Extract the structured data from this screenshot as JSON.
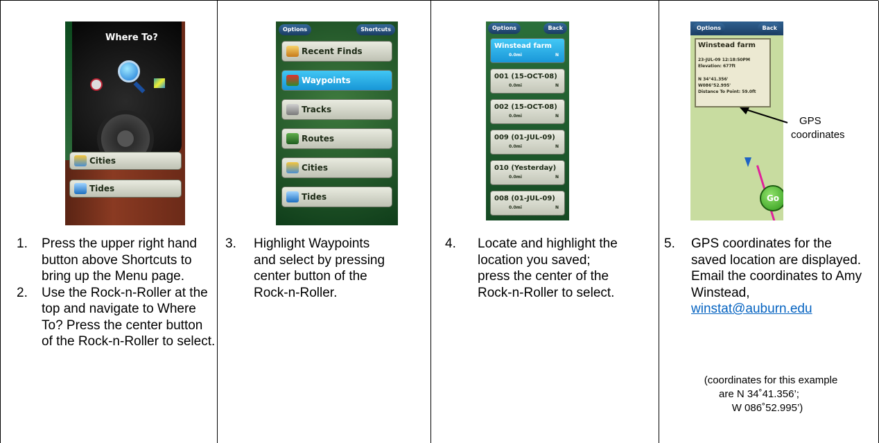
{
  "steps": {
    "step1": {
      "num": "1.",
      "text": "Press the upper right hand button above Shortcuts to bring up the Menu page."
    },
    "step2": {
      "num": "2.",
      "text": "Use the Rock-n-Roller at the top and navigate to Where To? Press the center button of the Rock-n-Roller to select."
    },
    "step3": {
      "num": "3.",
      "text": "Highlight Waypoints and select by pressing center button of the Rock-n-Roller."
    },
    "step4": {
      "num": "4.",
      "text": "Locate and highlight the location you saved; press the center of the Rock-n-Roller to select."
    },
    "step5": {
      "num": "5.",
      "text_before": "GPS coordinates for the saved location are displayed. Email the coordinates to Amy Winstead,",
      "email": "winstat@auburn.edu"
    }
  },
  "note": {
    "line1": "(coordinates for this example",
    "line2": "are N 34˚41.356’;",
    "line3": "W 086˚52.995’)"
  },
  "callout": {
    "line1": "GPS",
    "line2": "coordinates"
  },
  "screen1": {
    "title": "Where To?",
    "items": [
      "Cities",
      "Tides"
    ]
  },
  "screen2": {
    "options": "Options",
    "shortcuts": "Shortcuts",
    "items": [
      "Recent Finds",
      "Waypoints",
      "Tracks",
      "Routes",
      "Cities",
      "Tides"
    ],
    "selected": "Waypoints"
  },
  "screen3": {
    "options": "Options",
    "back": "Back",
    "waypoints": [
      {
        "name": "Winstead farm",
        "dist": "0.0mi",
        "dir": "N"
      },
      {
        "name": "001 (15-OCT-08)",
        "dist": "0.0mi",
        "dir": "N"
      },
      {
        "name": "002 (15-OCT-08)",
        "dist": "0.0mi",
        "dir": "N"
      },
      {
        "name": "009 (01-JUL-09)",
        "dist": "0.0mi",
        "dir": "N"
      },
      {
        "name": "010 (Yesterday)",
        "dist": "0.0mi",
        "dir": "N"
      },
      {
        "name": "008 (01-JUL-09)",
        "dist": "0.0mi",
        "dir": "N"
      }
    ]
  },
  "screen4": {
    "options": "Options",
    "back": "Back",
    "title": "Winstead farm",
    "date": "23-JUL-09 12:18:50PM",
    "elevation": "Elevation: 677ft",
    "lat": "N 34°41.356'",
    "lon": "W086°52.995'",
    "distance": "Distance To Point: 59.0ft",
    "go": "Go"
  },
  "colors": {
    "selected": "#1a97d8",
    "map_green": "#c8dca0",
    "link": "#0563c1"
  }
}
